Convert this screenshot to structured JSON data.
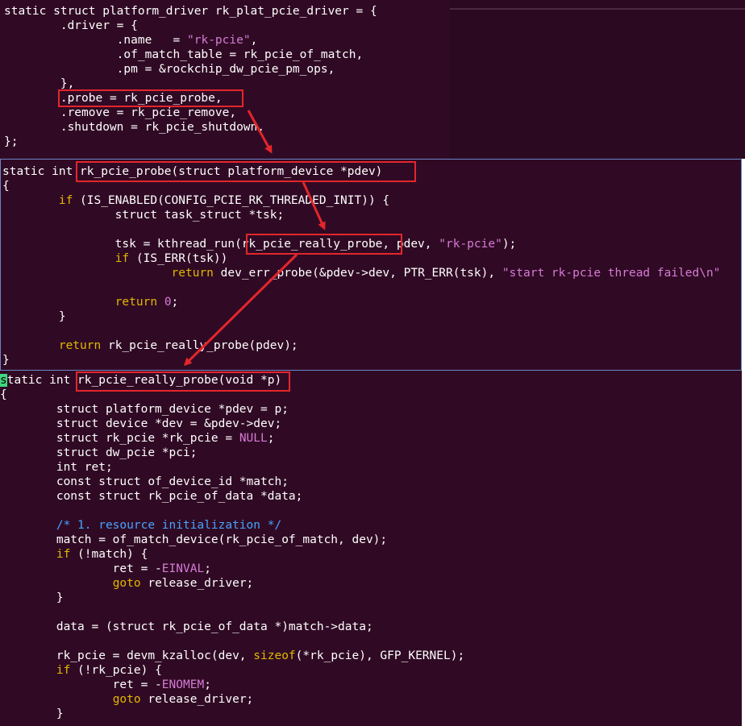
{
  "colors": {
    "terminal_bg": "#300a24",
    "text": "#ffffff",
    "string": "#d67bd6",
    "comment": "#45a4ff",
    "keyword_yellow": "#e2b800",
    "highlight_box": "#e3262b",
    "focus_border": "#6b86c7",
    "cursor": "#3fd780"
  },
  "panel1": {
    "lines": [
      "static struct platform_driver rk_plat_pcie_driver = {",
      "        .driver = {",
      "                .name   = \"rk-pcie\",",
      "                .of_match_table = rk_pcie_of_match,",
      "                .pm = &rockchip_dw_pcie_pm_ops,",
      "        },",
      "        .probe = rk_pcie_probe,",
      "        .remove = rk_pcie_remove,",
      "        .shutdown = rk_pcie_shutdown,",
      "};"
    ]
  },
  "panel2": {
    "lines": [
      "static int rk_pcie_probe(struct platform_device *pdev)",
      "{",
      "        if (IS_ENABLED(CONFIG_PCIE_RK_THREADED_INIT)) {",
      "                struct task_struct *tsk;",
      "",
      "                tsk = kthread_run(rk_pcie_really_probe, pdev, \"rk-pcie\");",
      "                if (IS_ERR(tsk))",
      "                        return dev_err_probe(&pdev->dev, PTR_ERR(tsk), \"start rk-pcie thread failed\\n\"",
      "",
      "                return 0;",
      "        }",
      "",
      "        return rk_pcie_really_probe(pdev);",
      "}"
    ]
  },
  "panel3": {
    "lines": [
      "static int rk_pcie_really_probe(void *p)",
      "{",
      "        struct platform_device *pdev = p;",
      "        struct device *dev = &pdev->dev;",
      "        struct rk_pcie *rk_pcie = NULL;",
      "        struct dw_pcie *pci;",
      "        int ret;",
      "        const struct of_device_id *match;",
      "        const struct rk_pcie_of_data *data;",
      "",
      "        /* 1. resource initialization */",
      "        match = of_match_device(rk_pcie_of_match, dev);",
      "        if (!match) {",
      "                ret = -EINVAL;",
      "                goto release_driver;",
      "        }",
      "",
      "        data = (struct rk_pcie_of_data *)match->data;",
      "",
      "        rk_pcie = devm_kzalloc(dev, sizeof(*rk_pcie), GFP_KERNEL);",
      "        if (!rk_pcie) {",
      "                ret = -ENOMEM;",
      "                goto release_driver;",
      "        }"
    ]
  }
}
